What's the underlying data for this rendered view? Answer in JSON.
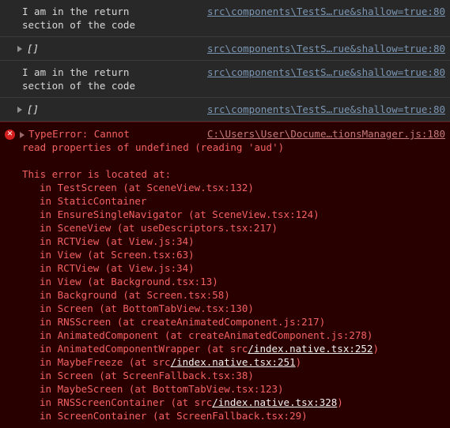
{
  "console": {
    "rows": [
      {
        "kind": "log",
        "expandable": false,
        "message": "I am in the return\nsection of the code",
        "italic": false,
        "source": "src\\components\\TestS…rue&shallow=true:80"
      },
      {
        "kind": "log",
        "expandable": true,
        "message": "[]",
        "italic": true,
        "source": "src\\components\\TestS…rue&shallow=true:80"
      },
      {
        "kind": "log",
        "expandable": false,
        "message": "I am in the return\nsection of the code",
        "italic": false,
        "source": "src\\components\\TestS…rue&shallow=true:80"
      },
      {
        "kind": "log",
        "expandable": true,
        "message": "[]",
        "italic": true,
        "source": "src\\components\\TestS…rue&shallow=true:80"
      }
    ],
    "error": {
      "icon": "error-circle-x-icon",
      "icon_glyph": "✕",
      "expandable": true,
      "title": "TypeError: Cannot",
      "source": "C:\\Users\\User\\Docume…tionsManager.js:180",
      "body": "read properties of undefined (reading 'aud')",
      "located_label": "This error is located at:",
      "stack": [
        {
          "text": "in TestScreen (at SceneView.tsx:132)",
          "link": null
        },
        {
          "text": "in StaticContainer",
          "link": null
        },
        {
          "text": "in EnsureSingleNavigator (at SceneView.tsx:124)",
          "link": null
        },
        {
          "text": "in SceneView (at useDescriptors.tsx:217)",
          "link": null
        },
        {
          "text": "in RCTView (at View.js:34)",
          "link": null
        },
        {
          "text": "in View (at Screen.tsx:63)",
          "link": null
        },
        {
          "text": "in RCTView (at View.js:34)",
          "link": null
        },
        {
          "text": "in View (at Background.tsx:13)",
          "link": null
        },
        {
          "text": "in Background (at Screen.tsx:58)",
          "link": null
        },
        {
          "text": "in Screen (at BottomTabView.tsx:130)",
          "link": null
        },
        {
          "text": "in RNSScreen (at createAnimatedComponent.js:217)",
          "link": null
        },
        {
          "text": "in AnimatedComponent (at createAnimatedComponent.js:278)",
          "link": null
        },
        {
          "prefix": "in AnimatedComponentWrapper (at src",
          "link": "/index.native.tsx:252",
          "suffix": ")"
        },
        {
          "prefix": "in MaybeFreeze (at src",
          "link": "/index.native.tsx:251",
          "suffix": ")"
        },
        {
          "text": "in Screen (at ScreenFallback.tsx:38)",
          "link": null
        },
        {
          "text": "in MaybeScreen (at BottomTabView.tsx:123)",
          "link": null
        },
        {
          "prefix": "in RNSScreenContainer (at src",
          "link": "/index.native.tsx:328",
          "suffix": ")"
        },
        {
          "text": "in ScreenContainer (at ScreenFallback.tsx:29)",
          "link": null
        }
      ]
    },
    "colors": {
      "background": "#282828",
      "error_background": "#290000",
      "error_text": "#f26161",
      "link": "#7b96b3",
      "error_icon": "#d62020",
      "separator": "#3a3a3a"
    }
  }
}
